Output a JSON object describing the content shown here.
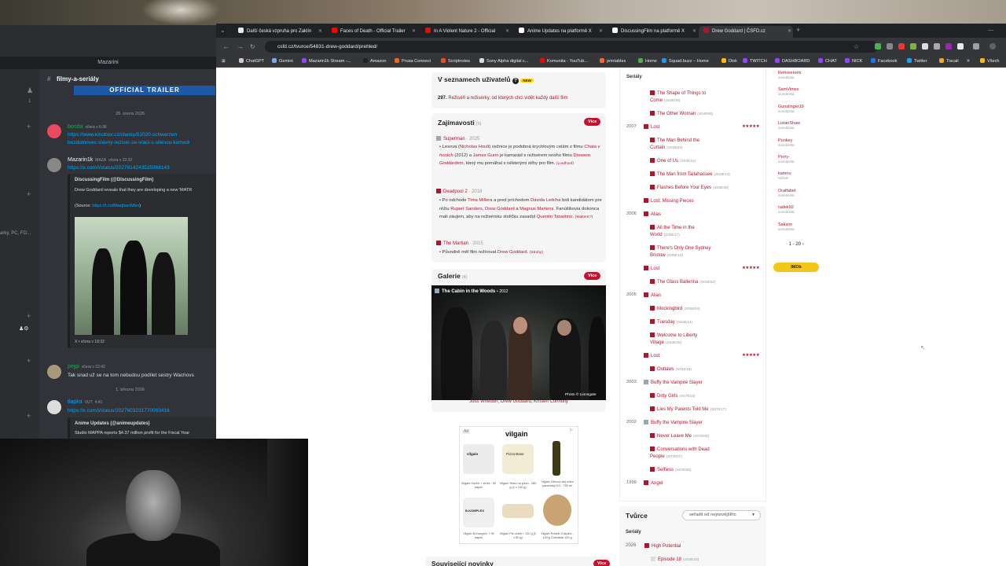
{
  "discord": {
    "title": "Mazarini",
    "channel": "filmy-a-seriály",
    "banner": "OFFICIAL TRAILER",
    "side_cut": "arky, PC, FO...",
    "date1": "28. února 2026",
    "date2": "1. března 2026",
    "m1": {
      "name": "bonda",
      "time": "včera v 6:36",
      "l1": "https://www.kinobox.cz/clanky/51020-schwarzen",
      "l2": "bezdomovec-slavny-reziser-se-vraci-s-silenou-komedi"
    },
    "m2": {
      "name": "Mazarin1k",
      "badge": "MAZA",
      "time": "včera v 22:32",
      "link": "https://x.com/i/status/2027814243525968143",
      "embed_title": "DiscussingFilm (@DiscussingFilm)",
      "embed_text": "Drew Goddard reveals that they are developing a new 'MATR",
      "embed_source": "(Source: ",
      "embed_source_link": "https://t.co/MwqhaxWtko",
      "embed_source_end": ")",
      "embed_footer": "X • včera v 19:32"
    },
    "m3": {
      "name": "pejpi",
      "time": "včera v 22:42",
      "text": "Tak snad už se na tom nebudou podílet sestry Wachovs"
    },
    "m4": {
      "name": "tlapka",
      "badge": "VUT",
      "time": "4:41",
      "link": "https://x.com/i/status/2027603231770083416",
      "embed_title": "Anime Updates (@animeupdates)",
      "embed_text": "Studio MAPPA reports $4.37 million profit for the Fiscal Year"
    }
  },
  "browser": {
    "tabs": [
      {
        "label": "Další česká vzpruha pro Zaklín",
        "color": "#e8eaed"
      },
      {
        "label": "Faces of Death - Official Trailer",
        "color": "#ff0000"
      },
      {
        "label": "In A Violent Nature 2 - Official",
        "color": "#ff0000"
      },
      {
        "label": "Anime Updates na platformě X",
        "color": "#ffffff"
      },
      {
        "label": "DiscussingFilm na platformě X",
        "color": "#ffffff"
      },
      {
        "label": "Drew Goddard | ČSFD.cz",
        "color": "#b5122c"
      }
    ],
    "url": "csfd.cz/tvurce/54831-drew-goddard/prehled/",
    "bookmarks": [
      "ChatGPT",
      "Gemini",
      "Mazarin1k Stream -...",
      "Amazon",
      "Prusa Connect",
      "Scriptnotes",
      "Sony Alpha digital c...",
      "Komunita - YouTub...",
      "printables",
      "Home",
      "Squad.buzz – Home",
      "Disk",
      "TWITCH",
      "DASHBOARD",
      "CHAT",
      "NICK",
      "Facebook",
      "Twitter",
      "Tiscali",
      "Všech"
    ]
  },
  "csfd": {
    "seznam": {
      "title": "V seznamech uživatelů",
      "badge": "NEW",
      "count": "297.",
      "text": "Režiséři a režisérky, od kterých chci vidět každý další film"
    },
    "zaj": {
      "title": "Zajímavosti",
      "count": "(9)",
      "more": "Více",
      "i1": {
        "film": "Superman",
        "year": "2025",
        "text_a": "Lexova (",
        "a1": "Nicholas Hoult",
        "text_b": ") vežnice je podobná krychlovým celám z filmu ",
        "a2": "Chata v horách",
        "text_c": " (2012) a ",
        "a3": "James Gunn",
        "text_d": " je kamarád s režisérem onoho filmu ",
        "a4": "Drewem Goddardem",
        "text_e": ", který mu pomáhal s některými stíhy pro film. ",
        "src": "(Lordhoof)"
      },
      "i2": {
        "film": "Deadpool 2",
        "year": "2018",
        "text_a": "Po odchode ",
        "a1": "Tima Millera",
        "text_b": " a pred príchodom ",
        "a2": "Davida Leitcha",
        "text_c": " boli kandidátom pre réžiu ",
        "a3": "Rupert Sanders",
        "text_d": ", ",
        "a4": "Drew Goddard",
        "text_e": " a ",
        "a5": "Magnus Martens",
        "text_f": ". Fanúšikovia dokonca mali záujem, aby na režisérsku stoličku zasadol ",
        "a6": "Quentin Tarantino",
        "text_g": ". ",
        "src": "(WalterK?)"
      },
      "i3": {
        "film": "The Martian",
        "year": "2015",
        "text_a": "Původně měl film režírovat ",
        "a1": "Drew Goddard",
        "text_b": ". ",
        "src": "(Struhy)"
      }
    },
    "galerie": {
      "title": "Galerie",
      "count": "(4)",
      "more": "Více",
      "photo_title": "The Cabin in the Woods",
      "photo_year": "2012",
      "credit": "Photo © Lionsgate",
      "caption": "Joss Whedon, Drew Goddard, Kristen Connolly"
    },
    "ad": {
      "label": "Ad",
      "brand": "vilgain",
      "products": [
        "Vilgain Hořčík + zinek - 90 kapslí",
        "Vilgain Těsto na pizzu - 280 g (2 x 140 g)",
        "Vilgain Olivový olej extra panenský DO - 750 ml",
        "Vilgain B-Komplex + 90 kapslí",
        "Vilgain Plo chleb + 120 g (2 x 60 g)",
        "Vilgain Protein Crispies - 120 g Čokoláda 120 g"
      ],
      "pack_labels": [
        "vilgain",
        "Pizza Base",
        "",
        "B-KOMPLEX",
        "",
        ""
      ]
    },
    "souvis": {
      "title": "Související novinky",
      "more": "Více"
    },
    "filmo": {
      "section": "Seriály",
      "rows": [
        {
          "kind": "item",
          "title": "The Shape of Things to Come",
          "sub": "(S04E09)"
        },
        {
          "kind": "item",
          "title": "The Other Woman",
          "sub": "(S04E06)"
        },
        {
          "kind": "year",
          "year": "2007",
          "title": "Lost",
          "stars": "★★★★★",
          "grey": false
        },
        {
          "kind": "item",
          "title": "The Man Behind the Curtain",
          "sub": "(S03E20)"
        },
        {
          "kind": "item",
          "title": "One of Us",
          "sub": "(S03E16)"
        },
        {
          "kind": "item",
          "title": "The Man from Tallahassee",
          "sub": "(S03E13)"
        },
        {
          "kind": "item",
          "title": "Flashes Before Your Eyes",
          "sub": "(S03E08)"
        },
        {
          "kind": "head",
          "title": "Lost: Missing Pieces"
        },
        {
          "kind": "year",
          "year": "2006",
          "title": "Alias",
          "stars": "",
          "grey": false
        },
        {
          "kind": "item",
          "title": "All the Time in the World",
          "sub": "(S05E17)"
        },
        {
          "kind": "item",
          "title": "There's Only One Sydney Bristow",
          "sub": "(S05E12)"
        },
        {
          "kind": "head",
          "title": "Lost",
          "stars": "★★★★★"
        },
        {
          "kind": "item",
          "title": "The Glass Ballerina",
          "sub": "(S03E02)"
        },
        {
          "kind": "year",
          "year": "2005",
          "title": "Alias",
          "stars": "",
          "grey": false
        },
        {
          "kind": "item",
          "title": "Mockingbird",
          "sub": "(S05E04)"
        },
        {
          "kind": "item",
          "title": "Tuesday",
          "sub": "(S04E13)"
        },
        {
          "kind": "item",
          "title": "Welcome to Liberty Village",
          "sub": "(S04E05)"
        },
        {
          "kind": "head",
          "title": "Lost",
          "stars": "★★★★★"
        },
        {
          "kind": "item",
          "title": "Outlaws",
          "sub": "(S01E16)"
        },
        {
          "kind": "year",
          "year": "2003",
          "title": "Buffy the Vampire Slayer",
          "stars": "",
          "grey": true
        },
        {
          "kind": "item",
          "title": "Dirty Girls",
          "sub": "(S07E18)"
        },
        {
          "kind": "item",
          "title": "Lies My Parents Told Me",
          "sub": "(S07E17)"
        },
        {
          "kind": "year",
          "year": "2002",
          "title": "Buffy the Vampire Slayer",
          "stars": "",
          "grey": true
        },
        {
          "kind": "item",
          "title": "Never Leave Me",
          "sub": "(S07E09)"
        },
        {
          "kind": "item",
          "title": "Conversations with Dead People",
          "sub": "(S07E07)"
        },
        {
          "kind": "item",
          "title": "Selfless",
          "sub": "(S07E05)"
        },
        {
          "kind": "year",
          "year": "1999",
          "title": "Angel",
          "stars": "",
          "grey": false
        }
      ]
    },
    "tvurce": {
      "title": "Tvůrce",
      "sort": "seřadit od nejnovějšího",
      "section": "Seriály",
      "year": "2026",
      "show": "High Potential",
      "episode": "Episode 18",
      "episode_sub": "(S02E18)"
    },
    "side": {
      "users": [
        {
          "name": "Remixeremi",
          "role": "scenárista"
        },
        {
          "name": "SamVimes",
          "role": "scenárista"
        },
        {
          "name": "Gunslinger19",
          "role": "scenárista"
        },
        {
          "name": "LizianShaw",
          "role": "scenárista"
        },
        {
          "name": "Punkey",
          "role": "scenárista"
        },
        {
          "name": "Perry-",
          "role": "scenárista"
        },
        {
          "name": "kamnu",
          "role": "režisér"
        },
        {
          "name": "Oralfabet",
          "role": "scenárista"
        },
        {
          "name": "radek92",
          "role": "scenárista"
        },
        {
          "name": "Saksim",
          "role": "scenárista"
        }
      ],
      "pager": "1 - 20",
      "imdb": "IMDb"
    }
  }
}
